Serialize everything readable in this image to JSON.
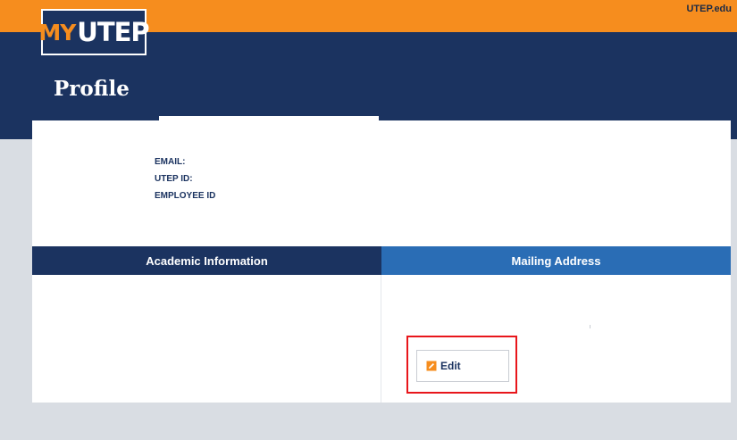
{
  "header": {
    "top_link": "UTEP.edu",
    "logo_my": "MY",
    "logo_utep": "UTEP",
    "page_title": "Profile"
  },
  "profile": {
    "email_label": "EMAIL:",
    "utep_id_label": "UTEP ID:",
    "employee_id_label": "EMPLOYEE ID"
  },
  "tabs": {
    "academic": "Academic Information",
    "mailing": "Mailing Address"
  },
  "mailing": {
    "edit_label": "Edit"
  },
  "colors": {
    "orange": "#f68d1e",
    "navy": "#1b3360",
    "blue": "#2a6db5",
    "highlight_red": "#e8161b"
  }
}
